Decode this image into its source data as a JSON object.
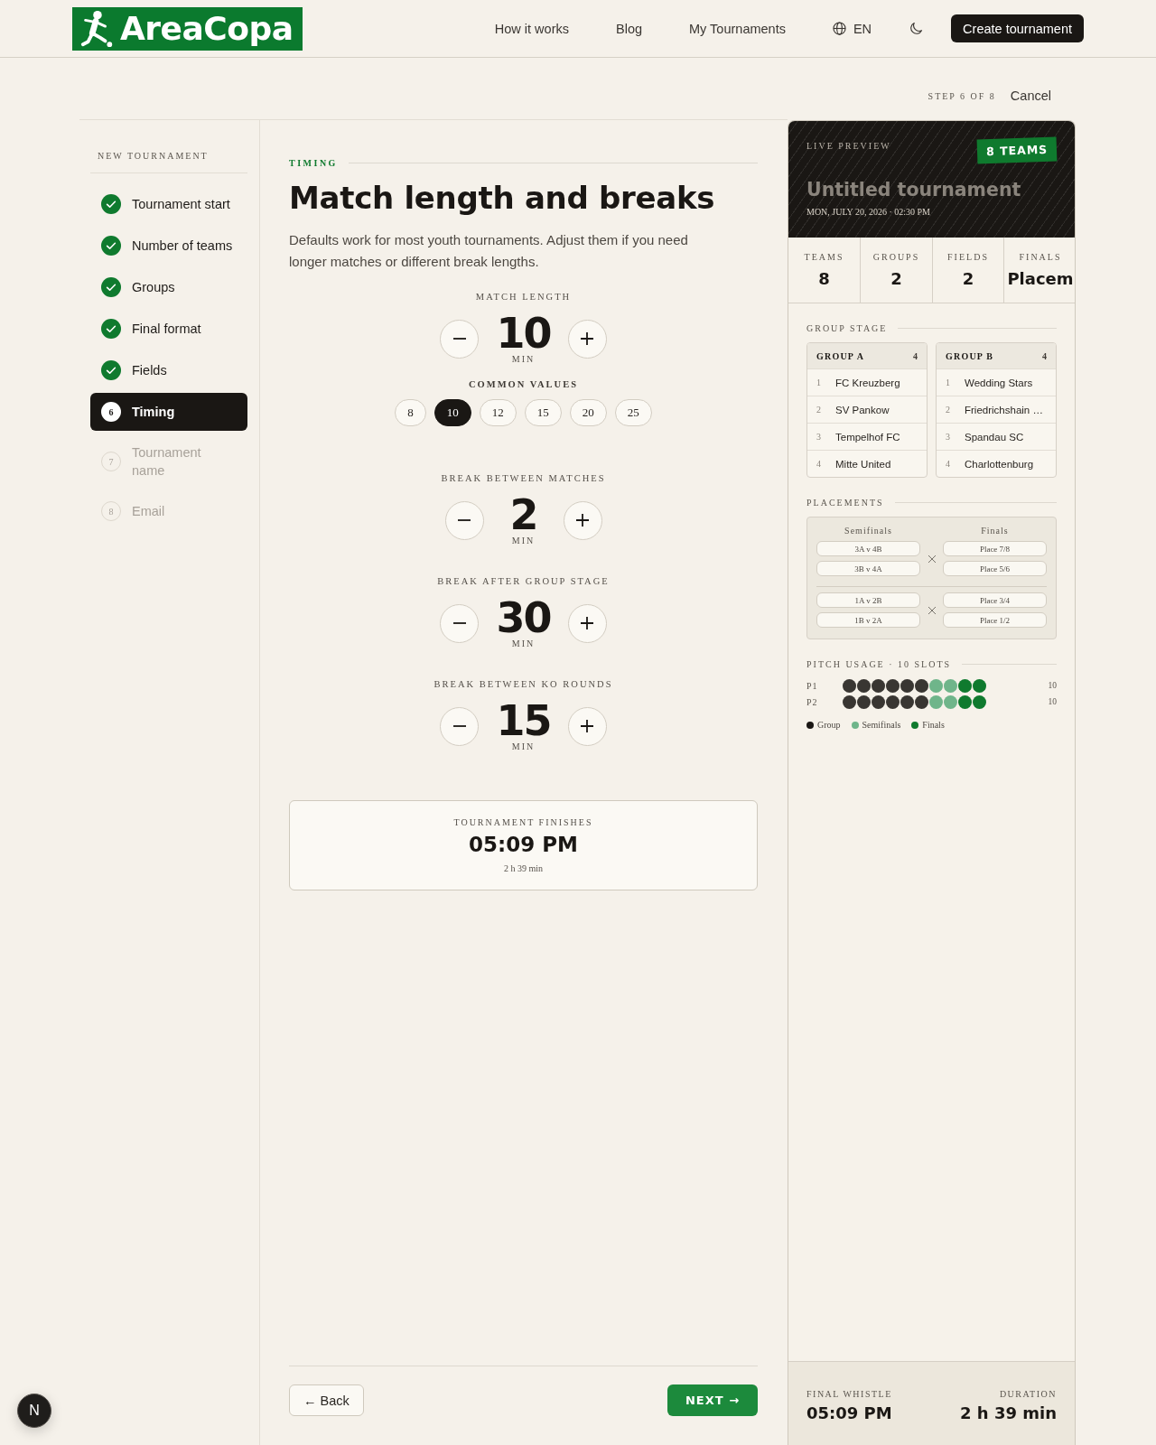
{
  "header": {
    "logo": "AreaCopa",
    "nav": [
      {
        "label": "How it works"
      },
      {
        "label": "Blog"
      },
      {
        "label": "My Tournaments"
      }
    ],
    "language": "EN",
    "cta": "Create tournament"
  },
  "progress": {
    "step": "STEP 6 OF 8",
    "cancel": "Cancel"
  },
  "sidebar": {
    "title": "NEW TOURNAMENT",
    "steps": [
      {
        "label": "Tournament start",
        "completed": true,
        "selected": false
      },
      {
        "label": "Number of teams",
        "completed": true,
        "selected": false
      },
      {
        "label": "Groups",
        "completed": true,
        "selected": false
      },
      {
        "label": "Final format",
        "completed": true,
        "selected": false
      },
      {
        "label": "Fields",
        "completed": true,
        "selected": false
      },
      {
        "number": "6",
        "label": "Timing",
        "completed": false,
        "selected": true
      },
      {
        "number": "7",
        "label": "Tournament name",
        "completed": false,
        "selected": false
      },
      {
        "number": "8",
        "label": "Email",
        "completed": false,
        "selected": false
      }
    ]
  },
  "main": {
    "section": "TIMING",
    "title": "Match length and breaks",
    "description": "Defaults work for most youth tournaments. Adjust them if you need longer matches or different break lengths.",
    "steppers": [
      {
        "label": "MATCH LENGTH",
        "value": "10",
        "unit": "MIN",
        "common_values": {
          "label": "COMMON VALUES",
          "options": [
            {
              "label": "8",
              "selected": false
            },
            {
              "label": "10",
              "selected": true
            },
            {
              "label": "12",
              "selected": false
            },
            {
              "label": "15",
              "selected": false
            },
            {
              "label": "20",
              "selected": false
            },
            {
              "label": "25",
              "selected": false
            }
          ]
        }
      },
      {
        "label": "BREAK BETWEEN MATCHES",
        "value": "2",
        "unit": "MIN"
      },
      {
        "label": "BREAK AFTER GROUP STAGE",
        "value": "30",
        "unit": "MIN"
      },
      {
        "label": "BREAK BETWEEN KO ROUNDS",
        "value": "15",
        "unit": "MIN"
      }
    ],
    "summary": {
      "label": "TOURNAMENT FINISHES",
      "time": "05:09 PM",
      "duration": "2 h 39 min"
    },
    "back": "← Back",
    "next": "NEXT →"
  },
  "preview": {
    "label": "LIVE PREVIEW",
    "badge": "8 TEAMS",
    "title": "Untitled tournament",
    "date": "MON, JULY 20, 2026 · 02:30 PM",
    "stats": [
      {
        "label": "TEAMS",
        "value": "8"
      },
      {
        "label": "GROUPS",
        "value": "2"
      },
      {
        "label": "FIELDS",
        "value": "2"
      },
      {
        "label": "FINALS",
        "value": "Placem"
      }
    ],
    "group_stage": {
      "title": "GROUP STAGE",
      "groups": [
        {
          "name": "GROUP A",
          "count": "4",
          "teams": [
            {
              "rank": "1",
              "name": "FC Kreuzberg"
            },
            {
              "rank": "2",
              "name": "SV Pankow"
            },
            {
              "rank": "3",
              "name": "Tempelhof FC"
            },
            {
              "rank": "4",
              "name": "Mitte United"
            }
          ]
        },
        {
          "name": "GROUP B",
          "count": "4",
          "teams": [
            {
              "rank": "1",
              "name": "Wedding Stars"
            },
            {
              "rank": "2",
              "name": "Friedrichshain …"
            },
            {
              "rank": "3",
              "name": "Spandau SC"
            },
            {
              "rank": "4",
              "name": "Charlottenburg"
            }
          ]
        }
      ]
    },
    "placements": {
      "title": "PLACEMENTS",
      "columns": [
        "Semifinals",
        "Finals"
      ],
      "rounds": [
        {
          "semifinals": [
            "3A v 4B",
            "3B v 4A"
          ],
          "finals": [
            "Place 7/8",
            "Place 5/6"
          ]
        },
        {
          "semifinals": [
            "1A v 2B",
            "1B v 2A"
          ],
          "finals": [
            "Place 3/4",
            "Place 1/2"
          ]
        }
      ]
    },
    "pitch_usage": {
      "title": "PITCH USAGE · 10 SLOTS",
      "pitches": [
        {
          "label": "P1",
          "count": "10",
          "slots": [
            {
              "kind": "group"
            },
            {
              "kind": "group"
            },
            {
              "kind": "group"
            },
            {
              "kind": "group"
            },
            {
              "kind": "group"
            },
            {
              "kind": "group"
            },
            {
              "kind": "semifinals"
            },
            {
              "kind": "semifinals"
            },
            {
              "kind": "finals"
            },
            {
              "kind": "finals"
            }
          ]
        },
        {
          "label": "P2",
          "count": "10",
          "slots": [
            {
              "kind": "group"
            },
            {
              "kind": "group"
            },
            {
              "kind": "group"
            },
            {
              "kind": "group"
            },
            {
              "kind": "group"
            },
            {
              "kind": "group"
            },
            {
              "kind": "semifinals"
            },
            {
              "kind": "semifinals"
            },
            {
              "kind": "finals"
            },
            {
              "kind": "finals"
            }
          ]
        }
      ],
      "legend": [
        {
          "kind": "group",
          "label": "Group",
          "color": "#1a1714"
        },
        {
          "kind": "semifinals",
          "label": "Semifinals",
          "color": "#6fb58a"
        },
        {
          "kind": "finals",
          "label": "Finals",
          "color": "#0f7a2e"
        }
      ]
    },
    "footer": [
      {
        "label": "FINAL WHISTLE",
        "value": "05:09 PM"
      },
      {
        "label": "DURATION",
        "value": "2 h 39 min"
      }
    ]
  },
  "dev_badge": "N"
}
